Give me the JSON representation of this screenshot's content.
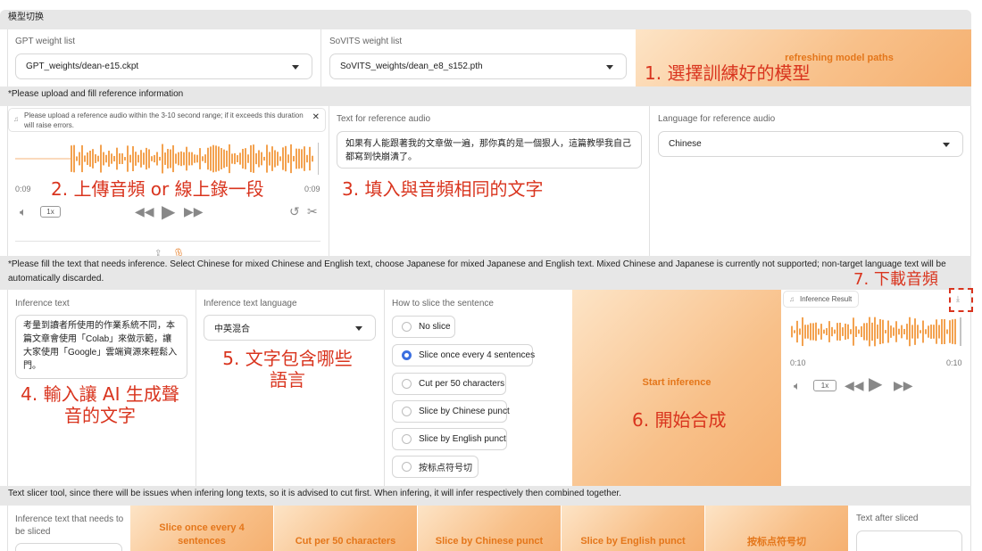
{
  "section_model": "模型切换",
  "gpt": {
    "label": "GPT weight list",
    "value": "GPT_weights/dean-e15.ckpt"
  },
  "sovits": {
    "label": "SoVITS weight list",
    "value": "SoVITS_weights/dean_e8_s152.pth"
  },
  "refresh_button": "refreshing model paths",
  "section_reference": "*Please upload and fill reference information",
  "ref_audio": {
    "notice": "Please upload a reference audio within the 3-10 second range; if it exceeds this duration will raise errors.",
    "time_left": "0:09",
    "time_right": "0:09",
    "speed": "1x"
  },
  "ref_text": {
    "label": "Text for reference audio",
    "value": "如果有人能跟著我的文章做一遍，那你真的是一個狠人，這篇教學我自己都寫到快崩潰了。"
  },
  "ref_lang": {
    "label": "Language for reference audio",
    "value": "Chinese"
  },
  "section_inference": "*Please fill the text that needs inference. Select Chinese for mixed Chinese and English text, choose Japanese for mixed Japanese and English text. Mixed Chinese and Japanese is currently not supported; non-target language text will be automatically discarded.",
  "inf_text": {
    "label": "Inference text",
    "value": "考量到讀者所使用的作業系統不同，本篇文章會使用「Colab」來做示範，讓大家使用「Google」雲端資源來輕鬆入門。"
  },
  "inf_lang": {
    "label": "Inference text language",
    "value": "中英混合"
  },
  "slice": {
    "label": "How to slice the sentence",
    "options": [
      "No slice",
      "Slice once every 4 sentences",
      "Cut per 50 characters",
      "Slice by Chinese punct",
      "Slice by English punct",
      "按标点符号切"
    ],
    "selected_index": 1
  },
  "start_button": "Start inference",
  "result": {
    "label": "Inference Result",
    "time_left": "0:10",
    "time_right": "0:10",
    "speed": "1x"
  },
  "section_slicer": "Text slicer tool, since there will be issues when infering long texts, so it is advised to cut first. When infering, it will infer respectively then combined together.",
  "slicer": {
    "input_label": "Inference text that needs to be sliced",
    "buttons": [
      "Slice once every 4 sentences",
      "Cut per 50 characters",
      "Slice by Chinese punct",
      "Slice by English punct",
      "按标点符号切"
    ],
    "output_label": "Text after sliced"
  },
  "annotations": {
    "a1": "1. 選擇訓練好的模型",
    "a2": "2. 上傳音頻 or 線上錄一段",
    "a3": "3. 填入與音頻相同的文字",
    "a4": "4. 輸入讓 AI 生成聲音的文字",
    "a5": "5. 文字包含哪些語言",
    "a6": "6. 開始合成",
    "a7": "7. 下載音頻"
  },
  "colors": {
    "accent": "#e4761a",
    "annotation": "#d9341e",
    "waveform": "#f08a24",
    "radio_selected": "#3b6fe0"
  }
}
